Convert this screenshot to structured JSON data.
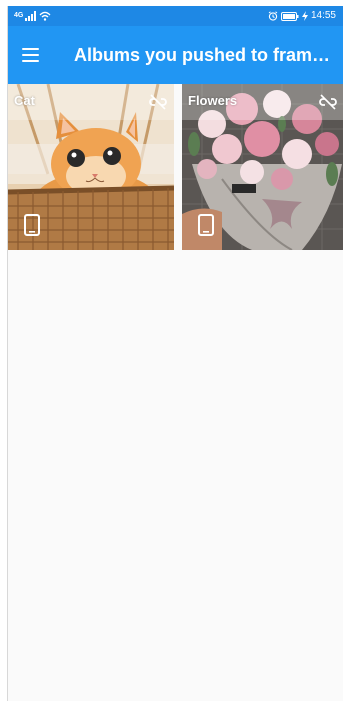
{
  "status_bar": {
    "network": "4G",
    "time": "14:55",
    "icons": [
      "signal-icon",
      "wifi-icon",
      "alarm-icon",
      "battery-icon",
      "charging-icon"
    ]
  },
  "app_bar": {
    "title": "Albums you pushed to frame...",
    "menu_icon": "hamburger-menu-icon"
  },
  "albums": [
    {
      "title": "Cat",
      "image": "cat-in-basket-photo",
      "link_icon": "unlink-icon",
      "device_icon": "tablet-icon"
    },
    {
      "title": "Flowers",
      "image": "flower-bouquet-photo",
      "link_icon": "unlink-icon",
      "device_icon": "tablet-icon"
    }
  ],
  "colors": {
    "status_bar": "#1e88e5",
    "app_bar": "#2196f3",
    "background": "#fafafa"
  }
}
